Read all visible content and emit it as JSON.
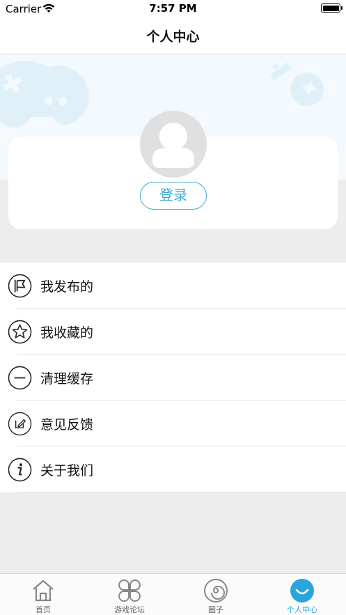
{
  "status_bar": {
    "carrier": "Carrier",
    "time": "7:57 PM"
  },
  "nav": {
    "title": "个人中心"
  },
  "profile": {
    "login_label": "登录"
  },
  "menu": {
    "items": [
      {
        "label": "我发布的",
        "icon": "flag-icon"
      },
      {
        "label": "我收藏的",
        "icon": "star-icon"
      },
      {
        "label": "清理缓存",
        "icon": "minus-circle-icon"
      },
      {
        "label": "意见反馈",
        "icon": "edit-icon"
      },
      {
        "label": "关于我们",
        "icon": "info-icon"
      }
    ]
  },
  "tabs": [
    {
      "label": "首页",
      "icon": "home-icon"
    },
    {
      "label": "游戏论坛",
      "icon": "clover-icon"
    },
    {
      "label": "圈子",
      "icon": "spiral-icon"
    },
    {
      "label": "个人中心",
      "icon": "smile-icon",
      "active": true
    }
  ],
  "colors": {
    "accent": "#2aa4dd",
    "login_border": "#3aa9d8",
    "page_bg": "#ededed"
  }
}
